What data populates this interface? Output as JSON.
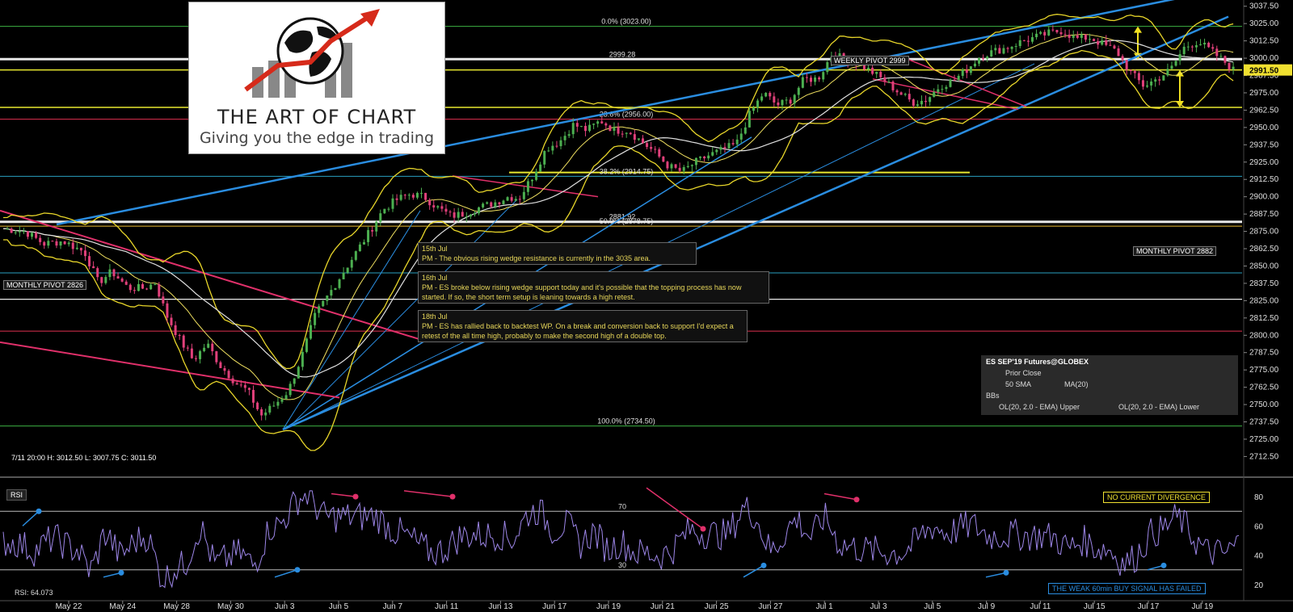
{
  "logo": {
    "title": "THE ART OF CHART",
    "tagline": "Giving you the edge in trading"
  },
  "ohlc_header": "7/11 20:00   H: 3012.50   L: 3007.75   C: 3011.50",
  "fib_labels": [
    {
      "text": "0.0% (3023.00)",
      "price": 3023
    },
    {
      "text": "2999.28",
      "price": 2999.28
    },
    {
      "text": "23.6% (2956.00)",
      "price": 2956
    },
    {
      "text": "38.2% (2914.75)",
      "price": 2914.75
    },
    {
      "text": "2881.92",
      "price": 2881.92
    },
    {
      "text": "50.0% (2878.75)",
      "price": 2878.75
    },
    {
      "text": "100.0% (2734.50)",
      "price": 2734.5
    }
  ],
  "pivots": {
    "weekly": "WEEKLY PIVOT 2999",
    "monthly_upper": "MONTHLY PIVOT 2882",
    "monthly_lower": "MONTHLY PIVOT 2826"
  },
  "last_price_label": "2991.50",
  "notes": [
    {
      "date": "15th Jul",
      "text": "PM - The obvious rising wedge resistance is currently in the 3035 area."
    },
    {
      "date": "16th Jul",
      "text": "PM - ES broke below rising wedge support today and it's possible that the topping process has now started. If so, the short term setup is leaning towards a high retest."
    },
    {
      "date": "18th Jul",
      "text": "PM - ES has rallied back to backtest WP. On a break and conversion back to support I'd expect a retest of the all time high, probably to make the second high of a double top."
    }
  ],
  "legend": {
    "title": "ES SEP'19 Futures@GLOBEX",
    "prior_close": "Prior Close",
    "sma": "50 SMA",
    "ma": "MA(20)",
    "bbs": "BBs",
    "upper": "OL(20, 2.0 - EMA) Upper",
    "lower": "OL(20, 2.0 - EMA) Lower"
  },
  "rsi": {
    "panel_label": "RSI",
    "value_label": "RSI: 64.073",
    "level_70": "70",
    "level_30": "30",
    "ticks": [
      "80",
      "60",
      "40",
      "20"
    ],
    "no_divergence": "NO CURRENT DIVERGENCE",
    "signal_failed": "THE WEAK 60min BUY SIGNAL HAS FAILED"
  },
  "colors": {
    "bg": "#000000",
    "candle_up": "#4caf50",
    "candle_down": "#e0407a",
    "bband": "#e8d62a",
    "sma50": "#e0e0e0",
    "ma20": "#f0e060",
    "trend_blue": "#2a8de0",
    "trend_red": "#e0306a",
    "rsi": "#9d86e8"
  },
  "chart_data": {
    "type": "candlestick",
    "symbol": "ES SEP'19 Futures@GLOBEX",
    "x_ticks": [
      "May 22",
      "May 24",
      "May 28",
      "May 30",
      "Jun 3",
      "Jun 5",
      "Jun 7",
      "Jun 11",
      "Jun 13",
      "Jun 17",
      "Jun 19",
      "Jun 21",
      "Jun 25",
      "Jun 27",
      "Jul 1",
      "Jul 3",
      "Jul 5",
      "Jul 9",
      "Jul 11",
      "Jul 15",
      "Jul 17",
      "Jul 19"
    ],
    "y_ticks": [
      3037.5,
      3025,
      3012.5,
      3000,
      2987.5,
      2975,
      2962.5,
      2950,
      2937.5,
      2925,
      2912.5,
      2900,
      2887.5,
      2875,
      2862.5,
      2850,
      2837.5,
      2825,
      2812.5,
      2800,
      2787.5,
      2775,
      2762.5,
      2750,
      2737.5,
      2725,
      2712.5
    ],
    "ylim": [
      2704,
      3042
    ],
    "close_path": [
      [
        0,
        2877
      ],
      [
        0.8,
        2875
      ],
      [
        1.5,
        2866
      ],
      [
        2.2,
        2868
      ],
      [
        3,
        2860
      ],
      [
        3.5,
        2838
      ],
      [
        4,
        2846
      ],
      [
        4.6,
        2834
      ],
      [
        5.2,
        2834
      ],
      [
        5.6,
        2838
      ],
      [
        6,
        2815
      ],
      [
        6.5,
        2797
      ],
      [
        7,
        2782
      ],
      [
        7.5,
        2794
      ],
      [
        8,
        2778
      ],
      [
        8.6,
        2765
      ],
      [
        9,
        2760
      ],
      [
        9.5,
        2742
      ],
      [
        10,
        2750
      ],
      [
        10.5,
        2760
      ],
      [
        11,
        2785
      ],
      [
        11.5,
        2815
      ],
      [
        12,
        2830
      ],
      [
        12.5,
        2845
      ],
      [
        13,
        2860
      ],
      [
        13.5,
        2875
      ],
      [
        14,
        2891
      ],
      [
        14.5,
        2898
      ],
      [
        15,
        2902
      ],
      [
        15.5,
        2900
      ],
      [
        16,
        2892
      ],
      [
        16.5,
        2886
      ],
      [
        17,
        2888
      ],
      [
        17.5,
        2892
      ],
      [
        18,
        2895
      ],
      [
        18.6,
        2900
      ],
      [
        19,
        2899
      ],
      [
        19.5,
        2915
      ],
      [
        20,
        2935
      ],
      [
        20.5,
        2940
      ],
      [
        21,
        2952
      ],
      [
        21.5,
        2948
      ],
      [
        22,
        2955
      ],
      [
        22.5,
        2948
      ],
      [
        23,
        2948
      ],
      [
        23.5,
        2940
      ],
      [
        24,
        2932
      ],
      [
        24.5,
        2922
      ],
      [
        25,
        2918
      ],
      [
        25.5,
        2925
      ],
      [
        26,
        2930
      ],
      [
        26.5,
        2934
      ],
      [
        27,
        2938
      ],
      [
        27.5,
        2960
      ],
      [
        28,
        2975
      ],
      [
        28.5,
        2966
      ],
      [
        29,
        2970
      ],
      [
        29.5,
        2985
      ],
      [
        30,
        2985
      ],
      [
        30.5,
        3002
      ],
      [
        31,
        3000
      ],
      [
        31.5,
        2996
      ],
      [
        32,
        2990
      ],
      [
        32.5,
        2983
      ],
      [
        33,
        2975
      ],
      [
        33.5,
        2968
      ],
      [
        34,
        2970
      ],
      [
        34.5,
        2980
      ],
      [
        35,
        2984
      ],
      [
        35.5,
        2992
      ],
      [
        36,
        3002
      ],
      [
        36.5,
        3005
      ],
      [
        37,
        3008
      ],
      [
        37.5,
        3012
      ],
      [
        38,
        3015
      ],
      [
        38.5,
        3018
      ],
      [
        39,
        3020
      ],
      [
        39.5,
        3014
      ],
      [
        40,
        3015
      ],
      [
        40.5,
        3010
      ],
      [
        41,
        3005
      ],
      [
        41.5,
        2990
      ],
      [
        42,
        2980
      ],
      [
        42.5,
        2985
      ],
      [
        43,
        2992
      ],
      [
        43.5,
        3008
      ],
      [
        44,
        3012
      ],
      [
        44.5,
        3005
      ],
      [
        45,
        2997
      ],
      [
        45.3,
        2991.5
      ]
    ],
    "last_close": 2991.5,
    "rsi_levels": [
      70,
      30
    ],
    "rsi_ylim": [
      10,
      90
    ],
    "rsi_last": 64.073
  }
}
